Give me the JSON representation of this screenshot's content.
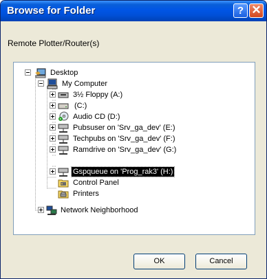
{
  "window": {
    "title": "Browse for Folder",
    "help_label": "?",
    "close_label": "✕"
  },
  "description": "Remote Plotter/Router(s)",
  "tree": {
    "items": [
      {
        "label": "Desktop",
        "icon": "desktop-icon",
        "expander": "minus"
      },
      {
        "label": "My Computer",
        "icon": "computer-icon",
        "expander": "minus"
      },
      {
        "label": "3½ Floppy (A:)",
        "icon": "floppy-drive-icon",
        "expander": "plus"
      },
      {
        "label": "(C:)",
        "icon": "hard-drive-icon",
        "expander": "plus"
      },
      {
        "label": "Audio CD (D:)",
        "icon": "cd-drive-icon",
        "expander": "plus"
      },
      {
        "label": "Pubsuser on 'Srv_ga_dev' (E:)",
        "icon": "network-drive-icon",
        "expander": "plus"
      },
      {
        "label": "Techpubs on 'Srv_ga_dev' (F:)",
        "icon": "network-drive-icon",
        "expander": "plus"
      },
      {
        "label": "Ramdrive on 'Srv_ga_dev' (G:)",
        "icon": "network-drive-icon",
        "expander": "plus"
      },
      {
        "label": "Gspqueue on 'Prog_rak3' (H:)",
        "icon": "network-drive-icon",
        "expander": "plus",
        "selected": true
      },
      {
        "label": "Control Panel",
        "icon": "control-panel-icon",
        "expander": "none"
      },
      {
        "label": "Printers",
        "icon": "printer-folder-icon",
        "expander": "none"
      },
      {
        "label": "Network Neighborhood",
        "icon": "network-icon",
        "expander": "plus"
      }
    ]
  },
  "buttons": {
    "ok_label": "OK",
    "cancel_label": "Cancel"
  },
  "colors": {
    "titlebar": "#0055e5",
    "dialog_bg": "#ece9d8",
    "selection_bg": "#000000"
  }
}
